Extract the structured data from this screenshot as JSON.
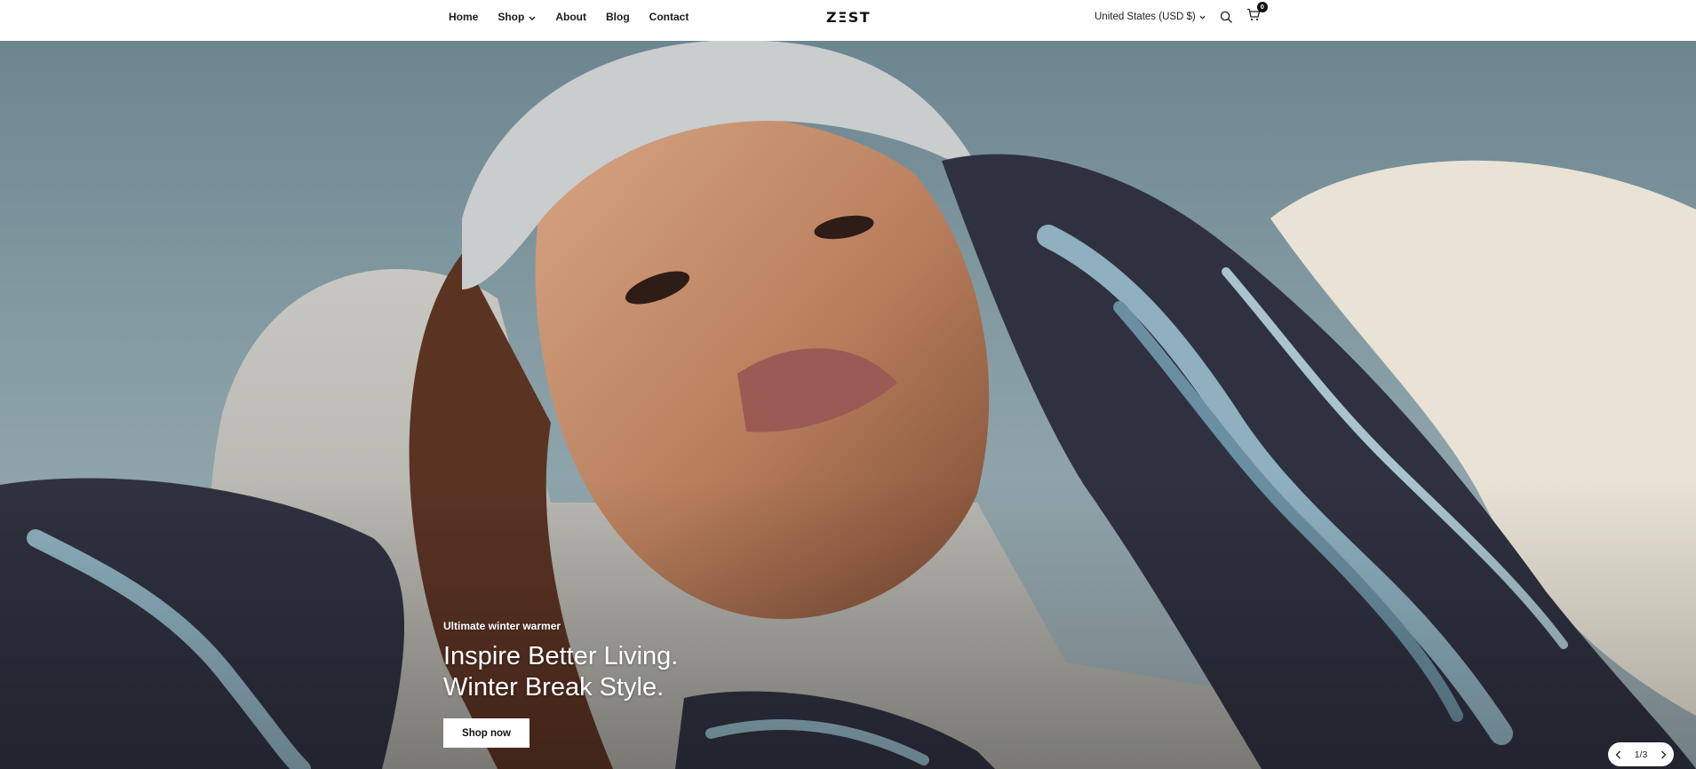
{
  "brand": {
    "logo_text": "ZΞST"
  },
  "nav": {
    "items": [
      {
        "label": "Home"
      },
      {
        "label": "Shop",
        "has_dropdown": true
      },
      {
        "label": "About"
      },
      {
        "label": "Blog"
      },
      {
        "label": "Contact"
      }
    ]
  },
  "header_right": {
    "currency": "United States (USD $)",
    "search_icon": "search-icon",
    "cart_icon": "cart-icon",
    "cart_count": "0"
  },
  "hero": {
    "eyebrow": "Ultimate winter warmer",
    "headline_line1": "Inspire Better Living.",
    "headline_line2": "Winter Break Style.",
    "cta_label": "Shop now",
    "pager_text": "1/3",
    "prev_icon": "chevron-left-icon",
    "next_icon": "chevron-right-icon"
  },
  "colors": {
    "header_bg": "#ffffff",
    "text_dark": "#1b1b1b",
    "hero_sky": "#7d949c",
    "sweater": "#b9b8b2",
    "scarf_dark": "#2f3140",
    "scarf_light": "#8eb0bf",
    "skin": "#c08d6e"
  }
}
